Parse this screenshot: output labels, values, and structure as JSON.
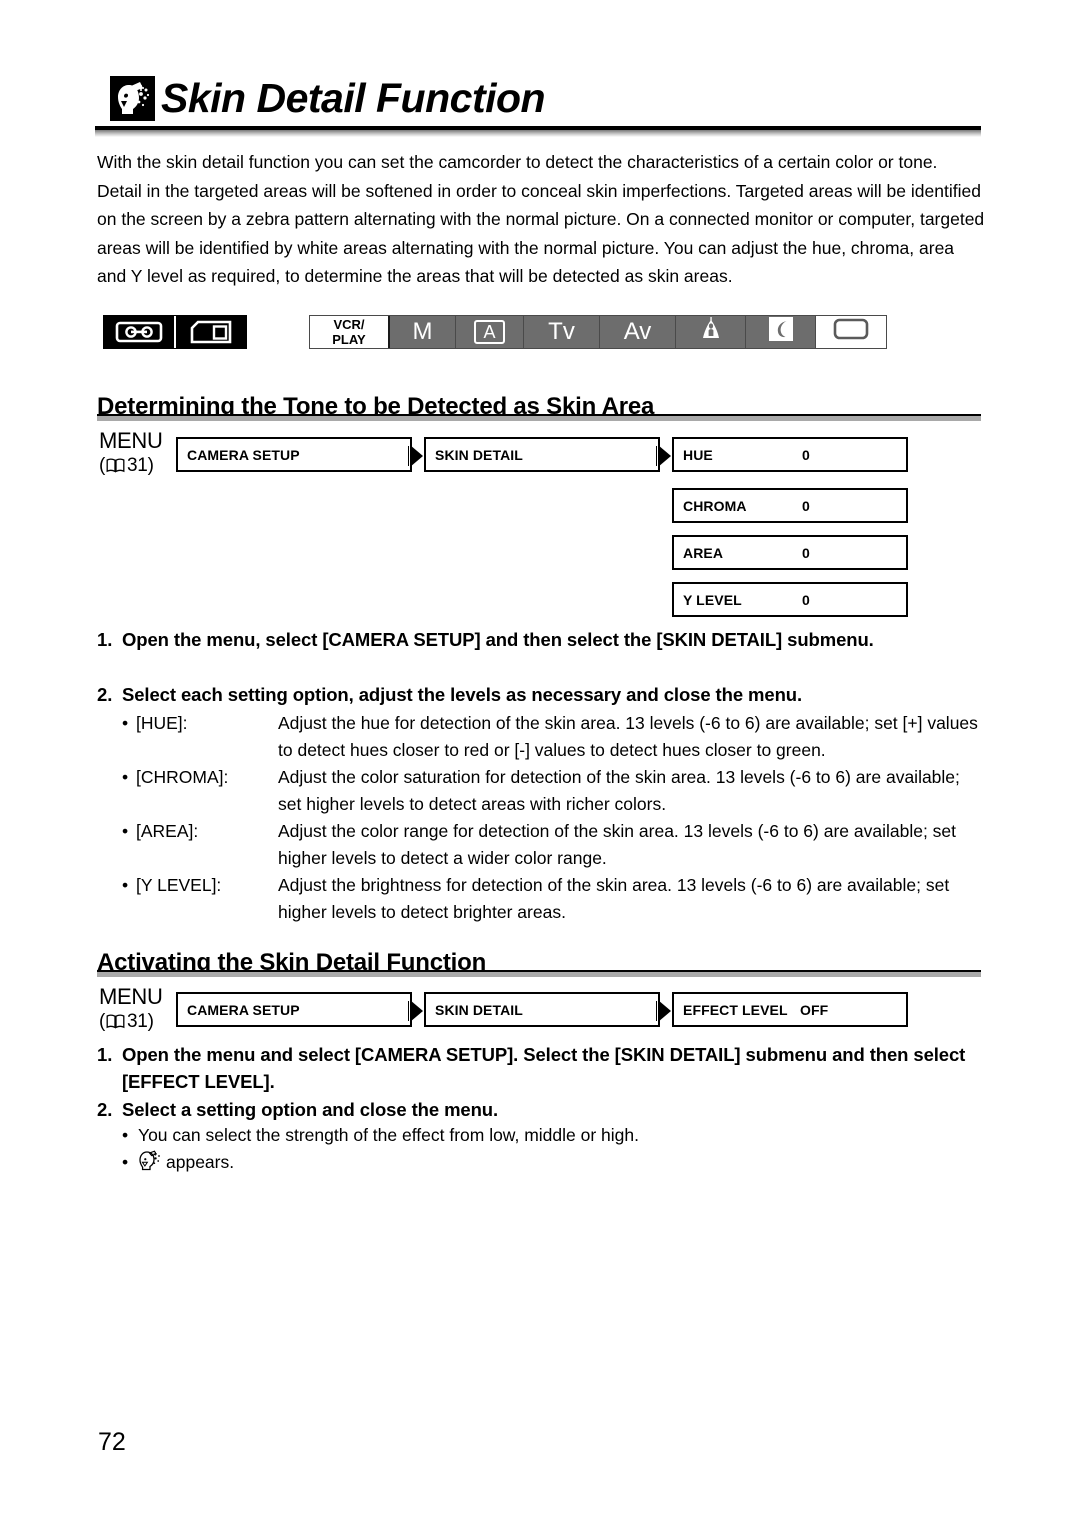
{
  "page": {
    "title": "Skin Detail Function",
    "page_number": "72",
    "title_icon": "skin-detail-face-icon"
  },
  "intro": {
    "paragraph": "With the skin detail function you can set the camcorder to detect the characteristics of a certain color or tone. Detail in the targeted areas will be softened in order to conceal skin imperfections. Targeted areas will be identified on the screen by a zebra pattern alternating with the normal picture. On a connected monitor or computer, targeted areas will be identified by white areas alternating with the normal picture. You can adjust the hue, chroma, area and Y level as required, to determine the areas that will be detected as skin areas."
  },
  "media_icons": [
    {
      "name": "tape-icon",
      "label": ""
    },
    {
      "name": "memory-card-icon",
      "label": ""
    }
  ],
  "mode_bar": [
    {
      "name": "mode-vcr-play",
      "label": "VCR/\nPLAY",
      "line1": "VCR/",
      "line2": "PLAY",
      "active": true
    },
    {
      "name": "mode-m",
      "label": "M",
      "active": false
    },
    {
      "name": "mode-auto",
      "label": "A",
      "active": false
    },
    {
      "name": "mode-tv",
      "label": "Tv",
      "active": false
    },
    {
      "name": "mode-av",
      "label": "Av",
      "active": false
    },
    {
      "name": "mode-portrait",
      "label": "",
      "icon": "portrait-icon",
      "active": false
    },
    {
      "name": "mode-night",
      "label": "",
      "icon": "moon-night-icon",
      "active": false
    },
    {
      "name": "mode-card",
      "label": "",
      "icon": "card-rec-icon",
      "active": true
    }
  ],
  "section1": {
    "heading": "Determining the Tone to be Detected as Skin Area",
    "menu": {
      "label": "MENU",
      "ref": "31",
      "ref_prefix": "(",
      "ref_suffix": ")",
      "boxes": [
        {
          "label": "CAMERA SETUP",
          "value": ""
        },
        {
          "label": "SKIN DETAIL",
          "value": ""
        }
      ],
      "options": [
        {
          "label": "HUE",
          "value": "0"
        },
        {
          "label": "CHROMA",
          "value": "0"
        },
        {
          "label": "AREA",
          "value": "0"
        },
        {
          "label": "Y LEVEL",
          "value": "0"
        }
      ]
    },
    "steps": [
      {
        "num": "1.",
        "text": "Open the menu, select [CAMERA SETUP] and then select the [SKIN DETAIL] submenu."
      },
      {
        "num": "2.",
        "text": "Select each setting option, adjust the levels as necessary and close the menu."
      }
    ],
    "bullets": [
      {
        "term": "[HUE]:",
        "desc": "Adjust the hue for detection of the skin area. 13 levels (-6 to 6) are available; set [+] values to detect hues closer to red or [-] values to detect hues closer to green."
      },
      {
        "term": "[CHROMA]:",
        "desc": "Adjust the color saturation for detection of the skin area. 13 levels (-6 to 6) are available; set higher levels to detect areas with richer colors."
      },
      {
        "term": "[AREA]:",
        "desc": "Adjust the color range for detection of the skin area. 13 levels (-6 to 6) are available; set higher levels to detect a wider color range."
      },
      {
        "term": "[Y LEVEL]:",
        "desc": "Adjust the brightness for detection of the skin area. 13 levels (-6 to 6) are available; set higher levels to detect brighter areas."
      }
    ]
  },
  "section2": {
    "heading": "Activating the Skin Detail Function",
    "menu": {
      "label": "MENU",
      "ref": "31",
      "boxes": [
        {
          "label": "CAMERA SETUP",
          "value": ""
        },
        {
          "label": "SKIN DETAIL",
          "value": ""
        },
        {
          "label": "EFFECT LEVEL",
          "value": "OFF"
        }
      ]
    },
    "steps": [
      {
        "num": "1.",
        "text": "Open the menu and select [CAMERA SETUP]. Select the [SKIN DETAIL] submenu and then select [EFFECT LEVEL]."
      },
      {
        "num": "2.",
        "text": "Select a setting option and close the menu."
      }
    ],
    "bullets": [
      {
        "text": "You can select the strength of the effect from low, middle or high."
      },
      {
        "text": "appears.",
        "icon": "skin-detail-face-icon"
      }
    ]
  }
}
